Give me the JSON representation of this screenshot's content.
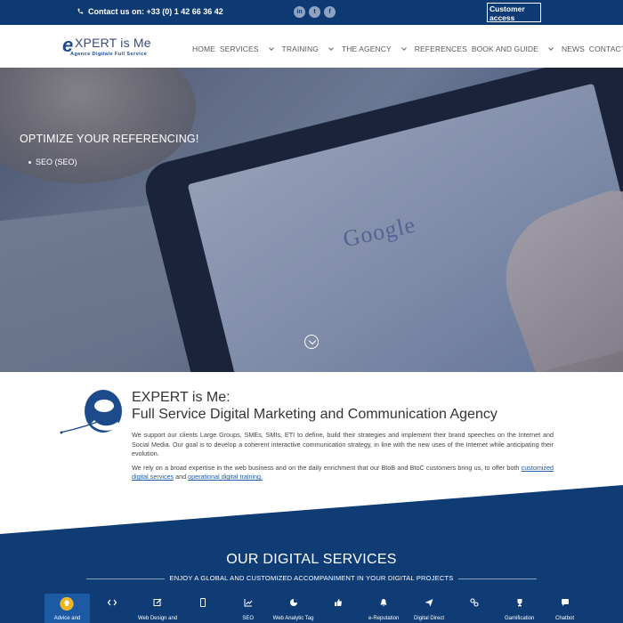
{
  "topbar": {
    "contact": "Contact us on: +33 (0) 1 42 66 36 42",
    "socials": [
      "in",
      "t",
      "f"
    ],
    "customer_access": "Customer access"
  },
  "header": {
    "logo_brand": "XPERT is Me",
    "logo_e": "e",
    "logo_tagline": "Agence Digitale Full Service",
    "nav": [
      "HOME",
      "SERVICES",
      "TRAINING",
      "THE AGENCY",
      "REFERENCES",
      "BOOK AND GUIDE",
      "NEWS",
      "CONTACT"
    ]
  },
  "hero": {
    "title": "OPTIMIZE YOUR REFERENCING!",
    "bullet": "SEO (SEO)",
    "screen_word": "Google"
  },
  "intro": {
    "title_line1": "EXPERT is Me:",
    "title_line2": "Full Service Digital Marketing and Communication Agency",
    "paragraph1": "We support our clients Large Groups, SMEs, SMIs, ETI to define, build their strategies and implement their brand speeches on the Internet and Social Media. Our goal is to develop a coherent interactive communication strategy, in line with the new uses of the Internet while anticipating their evolution.",
    "paragraph2_start": "We rely on a broad expertise in the web business and on the daily enrichment that our BtoB and BtoC customers bring us, to offer both ",
    "link1": "customized digital services",
    "paragraph2_mid": " and ",
    "link2": "operational digital training."
  },
  "services": {
    "title": "OUR DIGITAL SERVICES",
    "subtitle": "ENJOY A GLOBAL AND CUSTOMIZED ACCOMPANIMENT IN YOUR DIGITAL PROJECTS",
    "tabs": [
      "Advice and",
      "",
      "Web Design and",
      "",
      "SEO",
      "Web Analytic Tag",
      "",
      "e-Reputation",
      "Digital Direct",
      "",
      "Gamification",
      "Chatbot"
    ],
    "active_tab": 0
  },
  "colors": {
    "navy": "#0d3a73",
    "band": "#0f3c75",
    "link": "#1f5aa6"
  }
}
